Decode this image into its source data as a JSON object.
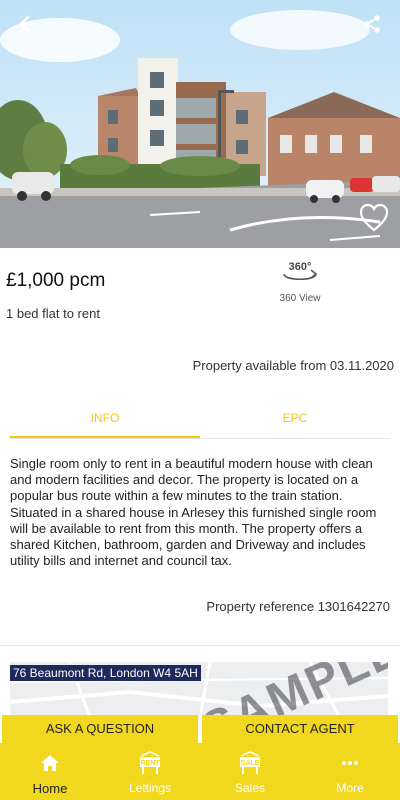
{
  "listing": {
    "price": "£1,000 pcm",
    "type": "1 bed flat to rent",
    "view360_icon_text": "360°",
    "view360_label": "360 View",
    "availability": "Property available from 03.11.2020",
    "description": "Single room only to rent in a beautiful modern house with clean and modern facilities and decor. The property is located on a popular bus route within a few minutes to the train station. Situated in a shared house in Arlesey this furnished single room will be available to rent from this month. The property offers a shared Kitchen, bathroom, garden and Driveway and includes utility bills and internet and council tax.",
    "reference": "Property reference 1301642270"
  },
  "tabs": [
    {
      "label": "INFO",
      "active": true
    },
    {
      "label": "EPC",
      "active": false
    }
  ],
  "map": {
    "address": "76 Beaumont Rd, London W4 5AH",
    "watermark": "SAMPLE"
  },
  "actions": {
    "ask": "ASK A QUESTION",
    "contact": "CONTACT AGENT"
  },
  "nav": [
    {
      "label": "Home",
      "icon": "home-icon",
      "active": true
    },
    {
      "label": "Lettings",
      "icon": "rent-sign-icon",
      "badge": "RENT",
      "active": false
    },
    {
      "label": "Sales",
      "icon": "sale-sign-icon",
      "badge": "SALE",
      "active": false
    },
    {
      "label": "More",
      "icon": "more-icon",
      "active": false
    }
  ],
  "colors": {
    "accent": "#f2d71f",
    "tab_accent": "#f2c812",
    "address_bg": "#1d2a5b"
  }
}
